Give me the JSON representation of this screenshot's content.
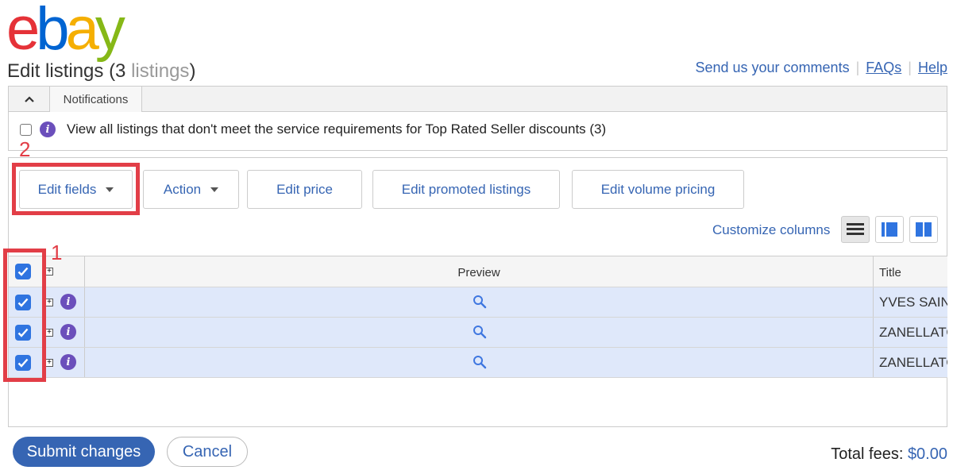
{
  "brand": {
    "letters": [
      "e",
      "b",
      "a",
      "y"
    ],
    "colors": [
      "#e53238",
      "#0064d2",
      "#f5af02",
      "#86b817"
    ]
  },
  "header": {
    "title": "Edit listings",
    "count_prefix": "(3",
    "count_word": " listings",
    "count_suffix": ")"
  },
  "toplinks": {
    "comments": "Send us your comments",
    "faqs": "FAQs",
    "help": "Help"
  },
  "notifications": {
    "tab_label": "Notifications",
    "message": "View all listings that don't meet the service requirements for Top Rated Seller discounts (3)"
  },
  "toolbar": {
    "edit_fields": "Edit fields",
    "action": "Action",
    "edit_price": "Edit price",
    "edit_promoted": "Edit promoted listings",
    "edit_volume": "Edit volume pricing",
    "customize_columns": "Customize columns"
  },
  "annotations": {
    "first": "1",
    "second": "2"
  },
  "table": {
    "col_preview": "Preview",
    "col_title": "Title",
    "rows": [
      {
        "title": "YVES SAINT"
      },
      {
        "title": "ZANELLATO"
      },
      {
        "title": "ZANELLATO"
      }
    ]
  },
  "footer": {
    "submit": "Submit changes",
    "cancel": "Cancel",
    "fees_label": "Total fees: ",
    "fees_value": "$0.00"
  },
  "colors": {
    "link": "#3665b3",
    "annotation": "#e23e47",
    "checkbox": "#2f74e0",
    "info": "#6b4fbb",
    "selected_row": "#dfe8fa"
  },
  "icons": [
    "chevron-up-icon",
    "info-icon",
    "caret-down-icon",
    "checkmark-icon",
    "expand-icon",
    "magnifier-icon",
    "list-view-icon",
    "gallery-view-icon",
    "split-view-icon"
  ]
}
